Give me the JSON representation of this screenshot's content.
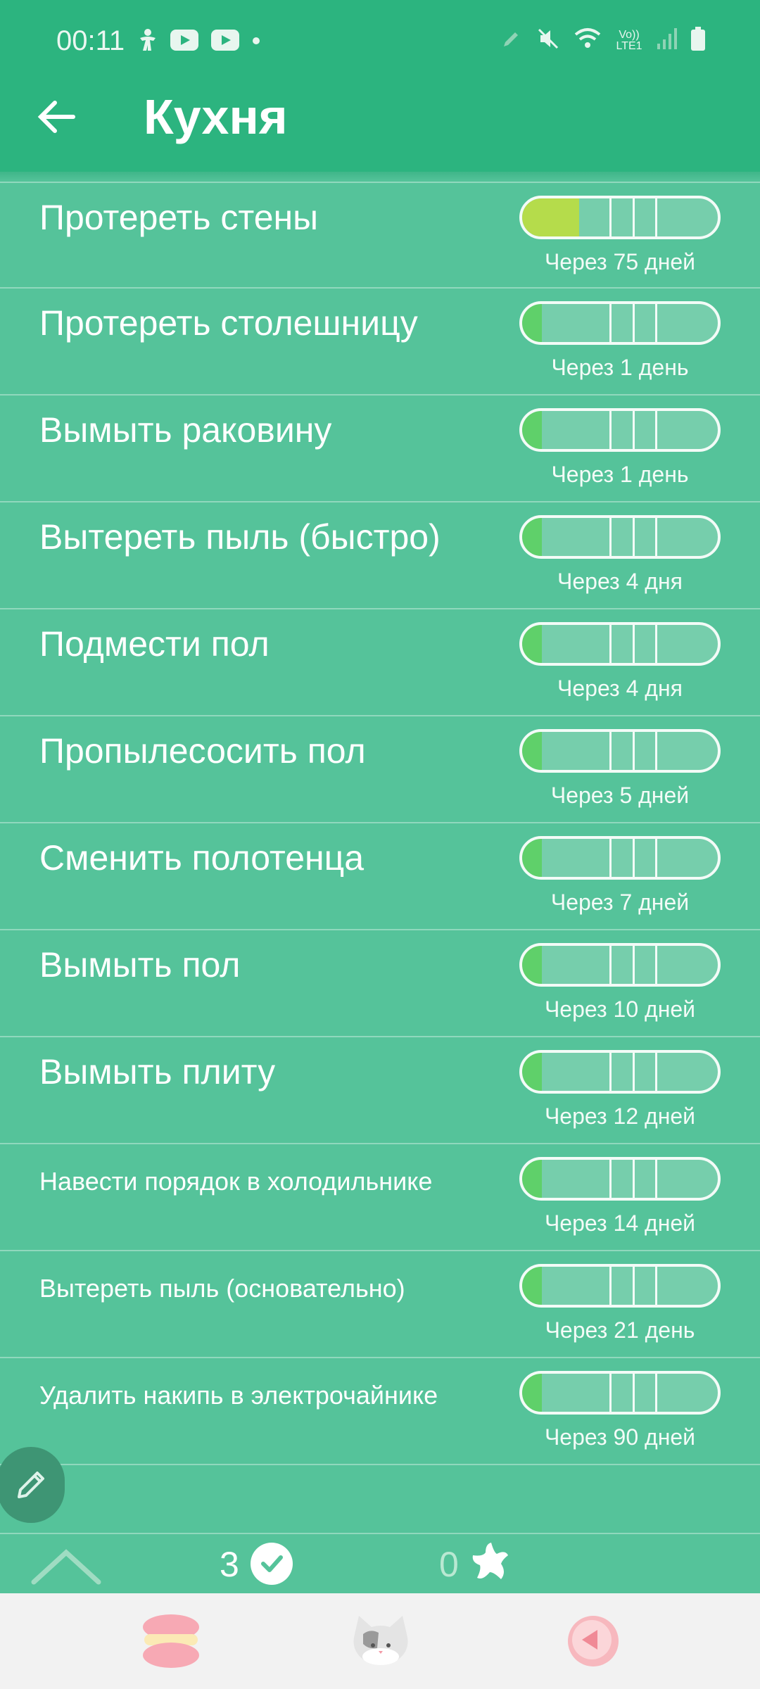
{
  "status_bar": {
    "time": "00:11",
    "left_icons": [
      "accessibility-icon",
      "youtube-icon",
      "youtube-icon",
      "dot-icon"
    ],
    "right_icons": [
      "pen-icon",
      "mute-icon",
      "wifi-icon",
      "volte-icon",
      "signal-icon",
      "battery-icon"
    ],
    "volte_text": "Vo)) LTE1"
  },
  "app_bar": {
    "title": "Кухня",
    "back_icon": "arrow-left-icon",
    "background": "#2cb47f"
  },
  "list_background": "#55c39a",
  "tasks": [
    {
      "name": "Протереть стены",
      "due": "Через 75 дней",
      "progress": 0.29,
      "fill_color": "#b5dc4b"
    },
    {
      "name": "Протереть столешницу",
      "due": "Через 1 день",
      "progress": 0.1,
      "fill_color": "#5fd06a"
    },
    {
      "name": "Вымыть раковину",
      "due": "Через 1 день",
      "progress": 0.1,
      "fill_color": "#5fd06a"
    },
    {
      "name": "Вытереть пыль (быстро)",
      "due": "Через 4 дня",
      "progress": 0.1,
      "fill_color": "#5fd06a"
    },
    {
      "name": "Подмести пол",
      "due": "Через 4 дня",
      "progress": 0.1,
      "fill_color": "#5fd06a"
    },
    {
      "name": "Пропылесосить пол",
      "due": "Через 5 дней",
      "progress": 0.1,
      "fill_color": "#5fd06a"
    },
    {
      "name": "Сменить полотенца",
      "due": "Через 7 дней",
      "progress": 0.1,
      "fill_color": "#5fd06a"
    },
    {
      "name": "Вымыть пол",
      "due": "Через 10 дней",
      "progress": 0.1,
      "fill_color": "#5fd06a"
    },
    {
      "name": "Вымыть плиту",
      "due": "Через 12 дней",
      "progress": 0.1,
      "fill_color": "#5fd06a"
    },
    {
      "name": "Навести порядок в холодильнике",
      "due": "Через 14 дней",
      "progress": 0.1,
      "fill_color": "#5fd06a"
    },
    {
      "name": "Вытереть пыль (основательно)",
      "due": "Через 21 день",
      "progress": 0.1,
      "fill_color": "#5fd06a"
    },
    {
      "name": "Удалить накипь в электрочайнике",
      "due": "Через 90 дней",
      "progress": 0.1,
      "fill_color": "#5fd06a"
    }
  ],
  "summary": {
    "done_count": "3",
    "star_count": "0",
    "expand_icon": "chevron-up-icon",
    "check_icon": "check-circle-icon",
    "star_icon": "splat-star-icon"
  },
  "fab": {
    "icon": "pencil-icon"
  },
  "bottom_nav": {
    "items": [
      {
        "icon": "macaron-icon"
      },
      {
        "icon": "cat-icon"
      },
      {
        "icon": "back-circle-icon"
      }
    ]
  }
}
